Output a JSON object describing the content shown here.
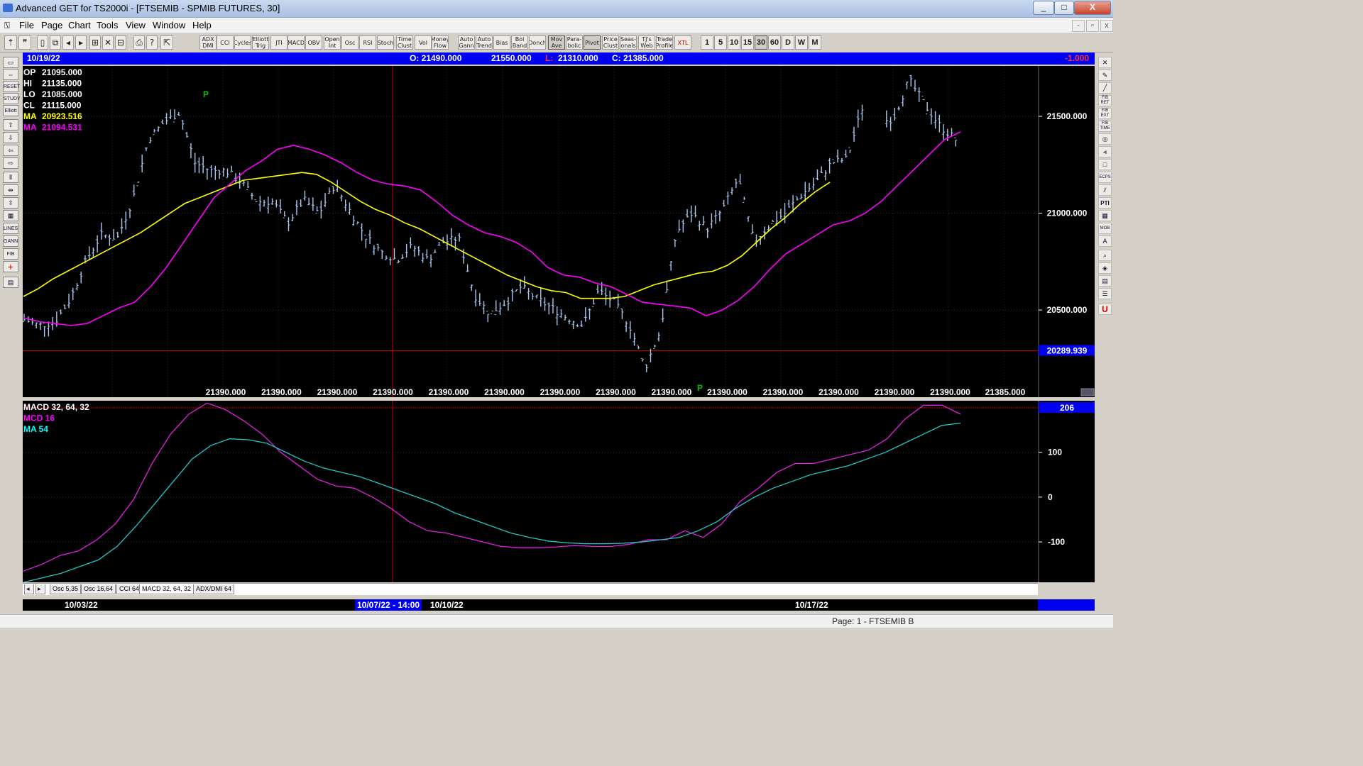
{
  "window": {
    "title": "Advanced GET for TS2000i - [FTSEMIB - SPMIB FUTURES, 30]",
    "buttons": [
      "_",
      "□",
      "X"
    ]
  },
  "menu": {
    "items": [
      "File",
      "Page",
      "Chart",
      "Tools",
      "View",
      "Window",
      "Help"
    ],
    "mdi_buttons": [
      "-",
      "▫",
      "x"
    ]
  },
  "toolbar": {
    "studies": [
      "ADX DMI",
      "CCI",
      "Cycles",
      "Elliott Trig",
      "JTI",
      "MACD",
      "OBV",
      "Open Int",
      "Osc",
      "RSI",
      "Stoch",
      "Time Clust",
      "Vol",
      "Money Flow",
      "Auto Gann",
      "Auto Trend",
      "Bias",
      "Bol Band",
      "Donch",
      "Mov Ave",
      "Para-bolic",
      "Pivot",
      "Price Clust",
      "Seas-onals",
      "TJ's Web",
      "Trade Profile",
      "XTL"
    ],
    "intervals": [
      "1",
      "5",
      "10",
      "15",
      "30",
      "60",
      "D",
      "W",
      "M"
    ],
    "active_interval": "30"
  },
  "left_tools": [
    "RESET",
    "STUDY",
    "Elliott",
    "LINES",
    "GANN",
    "FIB"
  ],
  "right_tools": [
    "FIB RET",
    "FIB EXT",
    "FIB TIME",
    "ECPS",
    "PTI",
    "MOB"
  ],
  "infobar": {
    "date": "10/19/22",
    "open": "O: 21490.000",
    "high": "21550.000",
    "low_label": "L:",
    "low": "21310.000",
    "close": "C: 21385.000",
    "change": "-1.000"
  },
  "price_panel": {
    "readouts": [
      {
        "label": "OP",
        "value": "21095.000",
        "color": "#ffffff"
      },
      {
        "label": "HI",
        "value": "21135.000",
        "color": "#ffffff"
      },
      {
        "label": "LO",
        "value": "21085.000",
        "color": "#ffffff"
      },
      {
        "label": "CL",
        "value": "21115.000",
        "color": "#ffffff"
      },
      {
        "label": "MA",
        "value": "20923.516",
        "color": "#ffff00"
      },
      {
        "label": "MA",
        "value": "21094.531",
        "color": "#ff00ff"
      }
    ],
    "axis_ticks": [
      "21500.000",
      "21000.000",
      "20500.000"
    ],
    "cursor_price": "20289.939",
    "bottom_labels": [
      "21390.000",
      "21390.000",
      "21390.000",
      "21390.000",
      "21390.000",
      "21390.000",
      "21390.000",
      "21390.000",
      "21390.000",
      "21390.000",
      "21390.000",
      "21390.000",
      "21390.000",
      "21390.000"
    ],
    "last_price": "21385.000",
    "pivot_marker": "P"
  },
  "macd_panel": {
    "readouts": [
      {
        "label": "MACD 32, 64, 32",
        "color": "#ffffff"
      },
      {
        "label": "MCD 16",
        "color": "#ff00ff"
      },
      {
        "label": "MA    54",
        "color": "#00ffff"
      }
    ],
    "axis_ticks": [
      "100",
      "0",
      "-100"
    ],
    "current_value": "206"
  },
  "tabs": [
    "Osc 5,35",
    "Osc 16,64",
    "CCI 64",
    "MACD 32, 64, 32",
    "ADX/DMI 64"
  ],
  "dates": {
    "d1": "10/03/22",
    "cursor": "10/07/22 - 14:00",
    "d2": "10/10/22",
    "d3": "10/17/22"
  },
  "status": "Page: 1 - FTSEMIB B",
  "colors": {
    "info_bg": "#0000f0",
    "ma_fast": "#ffff00",
    "ma_slow": "#ff00ff",
    "macd_line": "#e020e0",
    "macd_signal": "#20c8c8",
    "bars": "#a8c8f0",
    "cursor_line": "#c00000"
  },
  "chart_data": {
    "type": "line",
    "price": {
      "ylim": [
        20050,
        21760
      ],
      "yticks": [
        21500,
        21000,
        20500
      ],
      "bars": [],
      "ma_fast": [
        20570,
        20610,
        20660,
        20700,
        20740,
        20780,
        20820,
        20860,
        20900,
        20950,
        21000,
        21050,
        21080,
        21110,
        21140,
        21170,
        21180,
        21190,
        21200,
        21210,
        21200,
        21160,
        21110,
        21060,
        21020,
        20990,
        20950,
        20920,
        20880,
        20840,
        20800,
        20760,
        20720,
        20680,
        20650,
        20620,
        20600,
        20590,
        20560,
        20560,
        20560,
        20570,
        20600,
        20630,
        20650,
        20670,
        20690,
        20700,
        20730,
        20780,
        20850,
        20920,
        20980,
        21050,
        21110,
        21160
      ],
      "ma_slow": [
        20460,
        20440,
        20430,
        20420,
        20430,
        20470,
        20510,
        20540,
        20620,
        20720,
        20840,
        20960,
        21080,
        21150,
        21220,
        21270,
        21330,
        21350,
        21330,
        21300,
        21260,
        21210,
        21170,
        21150,
        21140,
        21120,
        21060,
        20990,
        20940,
        20900,
        20880,
        20850,
        20800,
        20720,
        20680,
        20670,
        20640,
        20620,
        20580,
        20540,
        20530,
        20520,
        20510,
        20470,
        20500,
        20550,
        20620,
        20710,
        20790,
        20840,
        20890,
        20940,
        20960,
        21000,
        21060,
        21140,
        21220,
        21300,
        21380,
        21420
      ]
    },
    "macd": {
      "ylim": [
        -190,
        215
      ],
      "yticks": [
        100,
        0,
        -100
      ],
      "macd_line": [
        -165,
        -150,
        -130,
        -120,
        -95,
        -60,
        -5,
        75,
        140,
        185,
        210,
        195,
        170,
        140,
        100,
        70,
        40,
        25,
        20,
        0,
        -25,
        -55,
        -75,
        -80,
        -90,
        -100,
        -110,
        -113,
        -113,
        -111,
        -108,
        -110,
        -110,
        -105,
        -95,
        -95,
        -75,
        -90,
        -60,
        -10,
        20,
        55,
        75,
        75,
        85,
        95,
        105,
        130,
        175,
        205,
        205,
        185
      ],
      "signal_line": [
        -190,
        -180,
        -170,
        -155,
        -140,
        -110,
        -65,
        -15,
        35,
        85,
        115,
        130,
        128,
        120,
        100,
        80,
        65,
        55,
        45,
        30,
        15,
        0,
        -15,
        -35,
        -50,
        -65,
        -80,
        -90,
        -98,
        -102,
        -104,
        -104,
        -103,
        -100,
        -95,
        -90,
        -75,
        -55,
        -25,
        0,
        20,
        35,
        50,
        60,
        70,
        85,
        100,
        120,
        140,
        160,
        165
      ]
    },
    "cursor_price": 20289.939
  }
}
